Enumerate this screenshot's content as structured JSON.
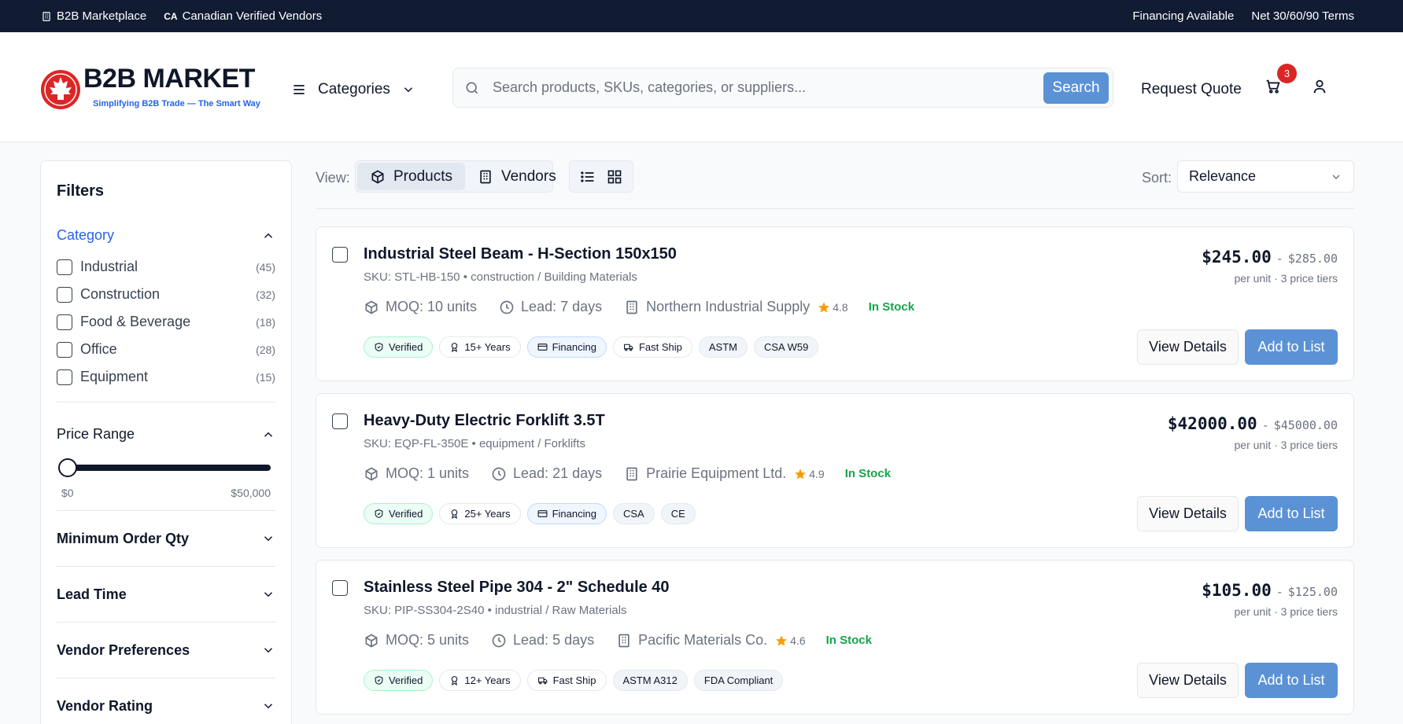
{
  "topbar": {
    "left_items": [
      "B2B Marketplace",
      "Canadian Verified Vendors"
    ],
    "ca_code": "CA",
    "right_items": [
      "Financing Available",
      "Net 30/60/90 Terms"
    ]
  },
  "header": {
    "logo_name": "B2B MARKET",
    "logo_tagline": "Simplifying B2B Trade — The Smart Way",
    "categories_label": "Categories",
    "search_placeholder": "Search products, SKUs, categories, or suppliers...",
    "search_button": "Search",
    "request_quote": "Request Quote",
    "cart_count": "3"
  },
  "filters": {
    "title": "Filters",
    "category_title": "Category",
    "categories": [
      {
        "label": "Industrial",
        "count": "(45)"
      },
      {
        "label": "Construction",
        "count": "(32)"
      },
      {
        "label": "Food & Beverage",
        "count": "(18)"
      },
      {
        "label": "Office",
        "count": "(28)"
      },
      {
        "label": "Equipment",
        "count": "(15)"
      }
    ],
    "price_title": "Price Range",
    "price_min": "$0",
    "price_max": "$50,000",
    "collapsed_sections": [
      "Minimum Order Qty",
      "Lead Time",
      "Vendor Preferences",
      "Vendor Rating"
    ]
  },
  "toolbar": {
    "view_label": "View:",
    "products_label": "Products",
    "vendors_label": "Vendors",
    "sort_label": "Sort:",
    "sort_value": "Relevance"
  },
  "products": [
    {
      "title": "Industrial Steel Beam - H-Section 150x150",
      "sku": "SKU: STL-HB-150 • construction / Building Materials",
      "moq": "MOQ: 10 units",
      "lead": "Lead: 7 days",
      "vendor": "Northern Industrial Supply",
      "rating": "4.8",
      "stock": "In Stock",
      "price_min": "$245.00",
      "price_sep": "-",
      "price_max": "$285.00",
      "price_note": "per unit · 3 price tiers",
      "tag_verified": "Verified",
      "tag_years": "15+ Years",
      "tag_financing": "Financing",
      "tag_ship": "Fast Ship",
      "certs": [
        "ASTM",
        "CSA W59"
      ],
      "view_label": "View Details",
      "add_label": "Add to List"
    },
    {
      "title": "Heavy-Duty Electric Forklift 3.5T",
      "sku": "SKU: EQP-FL-350E • equipment / Forklifts",
      "moq": "MOQ: 1 units",
      "lead": "Lead: 21 days",
      "vendor": "Prairie Equipment Ltd.",
      "rating": "4.9",
      "stock": "In Stock",
      "price_min": "$42000.00",
      "price_sep": "-",
      "price_max": "$45000.00",
      "price_note": "per unit · 3 price tiers",
      "tag_verified": "Verified",
      "tag_years": "25+ Years",
      "tag_financing": "Financing",
      "certs": [
        "CSA",
        "CE"
      ],
      "view_label": "View Details",
      "add_label": "Add to List"
    },
    {
      "title": "Stainless Steel Pipe 304 - 2\" Schedule 40",
      "sku": "SKU: PIP-SS304-2S40 • industrial / Raw Materials",
      "moq": "MOQ: 5 units",
      "lead": "Lead: 5 days",
      "vendor": "Pacific Materials Co.",
      "rating": "4.6",
      "stock": "In Stock",
      "price_min": "$105.00",
      "price_sep": "-",
      "price_max": "$125.00",
      "price_note": "per unit · 3 price tiers",
      "tag_verified": "Verified",
      "tag_years": "12+ Years",
      "tag_ship": "Fast Ship",
      "certs": [
        "ASTM A312",
        "FDA Compliant"
      ],
      "view_label": "View Details",
      "add_label": "Add to List"
    }
  ],
  "colors": {
    "topbar_bg": "#111c33",
    "accent_blue": "#5b92d6",
    "link_blue": "#2563eb",
    "stock_green": "#16a34a",
    "star": "#f59e0b",
    "badge_red": "#dc2626"
  }
}
